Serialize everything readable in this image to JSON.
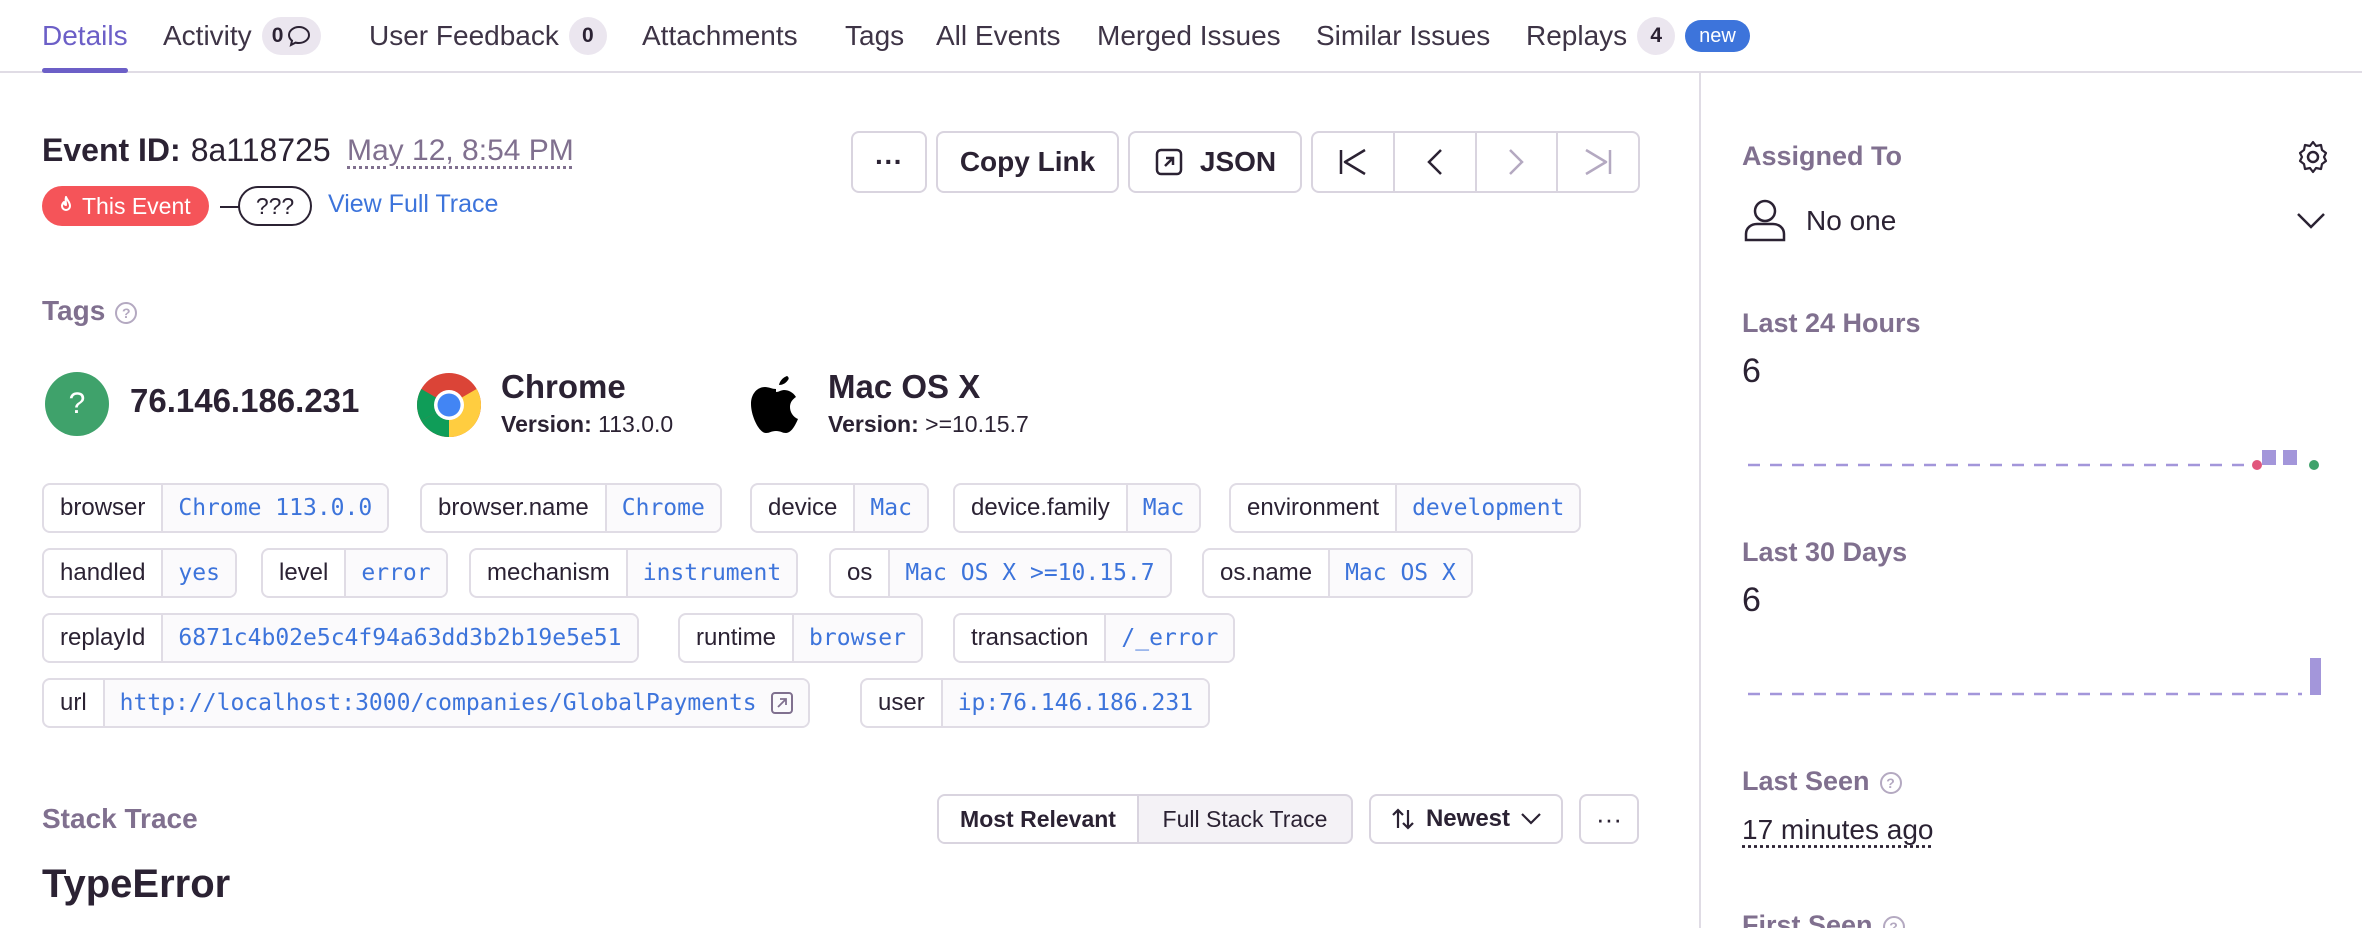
{
  "tabs": [
    {
      "label": "Details",
      "active": true
    },
    {
      "label": "Activity",
      "badge": "0"
    },
    {
      "label": "User Feedback",
      "badge": "0"
    },
    {
      "label": "Attachments"
    },
    {
      "label": "Tags"
    },
    {
      "label": "All Events"
    },
    {
      "label": "Merged Issues"
    },
    {
      "label": "Similar Issues"
    },
    {
      "label": "Replays",
      "badge": "4",
      "new_label": "new"
    }
  ],
  "event": {
    "id_label": "Event ID:",
    "id_value": "8a118725",
    "date": "May 12, 8:54 PM",
    "this_event_label": "This Event",
    "trace_placeholder": "???",
    "view_full_trace": "View Full Trace"
  },
  "toolbar": {
    "more_label": "···",
    "copy_link": "Copy Link",
    "json": "JSON"
  },
  "tags_section": {
    "title": "Tags",
    "contexts": {
      "ip": {
        "value": "76.146.186.231",
        "icon": "question-mark-icon"
      },
      "browser": {
        "name": "Chrome",
        "version_label": "Version:",
        "version": "113.0.0",
        "icon": "chrome-icon"
      },
      "os": {
        "name": "Mac OS X",
        "version_label": "Version:",
        "version": ">=10.15.7",
        "icon": "apple-icon"
      }
    },
    "tags": [
      {
        "key": "browser",
        "value": "Chrome 113.0.0"
      },
      {
        "key": "browser.name",
        "value": "Chrome"
      },
      {
        "key": "device",
        "value": "Mac"
      },
      {
        "key": "device.family",
        "value": "Mac"
      },
      {
        "key": "environment",
        "value": "development"
      },
      {
        "key": "handled",
        "value": "yes"
      },
      {
        "key": "level",
        "value": "error"
      },
      {
        "key": "mechanism",
        "value": "instrument"
      },
      {
        "key": "os",
        "value": "Mac OS X >=10.15.7"
      },
      {
        "key": "os.name",
        "value": "Mac OS X"
      },
      {
        "key": "replayId",
        "value": "6871c4b02e5c4f94a63dd3b2b19e5e51"
      },
      {
        "key": "runtime",
        "value": "browser"
      },
      {
        "key": "transaction",
        "value": "/_error"
      },
      {
        "key": "url",
        "value": "http://localhost:3000/companies/GlobalPayments"
      },
      {
        "key": "user",
        "value": "ip:76.146.186.231"
      }
    ]
  },
  "stack_trace": {
    "title": "Stack Trace",
    "view_most_relevant": "Most Relevant",
    "view_full": "Full Stack Trace",
    "sort_label": "Newest",
    "more_label": "···",
    "exception_type": "TypeError"
  },
  "sidebar": {
    "assigned_to_label": "Assigned To",
    "assignee": "No one",
    "last_24h_label": "Last 24 Hours",
    "last_24h_value": "6",
    "last_30d_label": "Last 30 Days",
    "last_30d_value": "6",
    "last_seen_label": "Last Seen",
    "last_seen_value": "17 minutes ago",
    "first_seen_label": "First Seen"
  },
  "colors": {
    "accent": "#6c5fc7",
    "link": "#3d74db",
    "error": "#f55459",
    "success": "#3fa26b",
    "release_marker": "#e1567c"
  }
}
